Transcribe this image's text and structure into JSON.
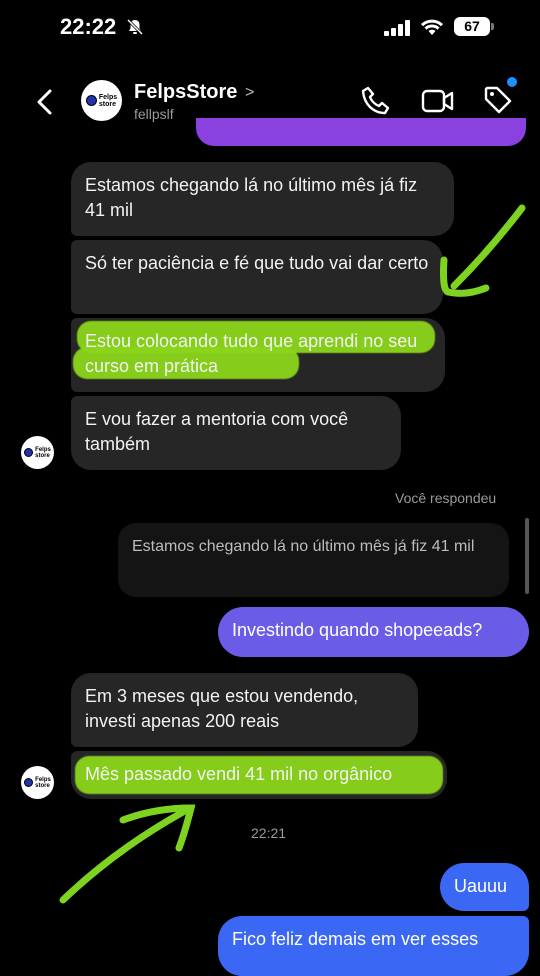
{
  "status_bar": {
    "time": "22:22",
    "battery": "67"
  },
  "header": {
    "name": "FelpsStore",
    "chevron": ">",
    "handle": "fellpslf",
    "logo_line1": "Felps",
    "logo_line2": "store"
  },
  "messages": {
    "m1": "Estamos chegando lá no último mês já fiz 41 mil",
    "m2": "Só ter paciência e fé que tudo vai dar certo",
    "m3": "Estou colocando tudo que aprendi no seu curso em prática",
    "m4": "E vou fazer a mentoria com você também",
    "reply_label": "Você respondeu",
    "quoted": "Estamos chegando lá no último mês já fiz 41 mil",
    "out1": "Investindo quando shopeeads?",
    "m5": "Em 3 meses que estou vendendo, investi apenas 200 reais",
    "m6": "Mês passado vendi 41 mil no orgânico",
    "timestamp": "22:21",
    "out2": "Uauuu",
    "out3": "Fico feliz demais em ver esses"
  },
  "colors": {
    "highlight": "#8bd61a",
    "bubble_in": "#262626",
    "bubble_purple": "#6b5ce7",
    "bubble_blue": "#3a68f5"
  },
  "icons": [
    "back-chevron-icon",
    "phone-icon",
    "video-camera-icon",
    "tag-icon",
    "bell-slash-icon",
    "signal-icon",
    "wifi-icon"
  ]
}
